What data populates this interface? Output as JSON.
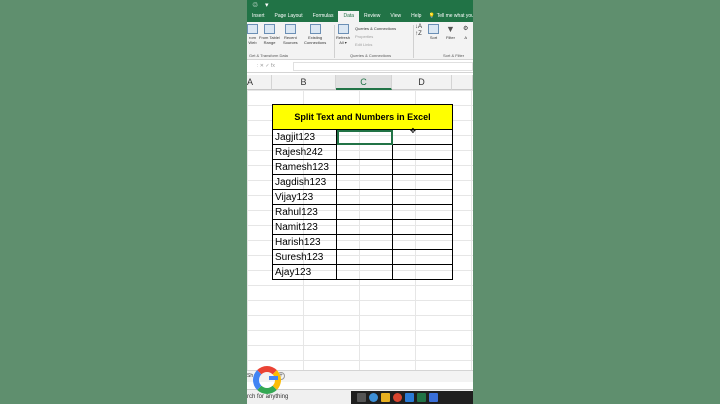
{
  "ribbon": {
    "tabs": [
      "Insert",
      "Page Layout",
      "Formulas",
      "Data",
      "Review",
      "View",
      "Help"
    ],
    "active_tab": "Data",
    "tell_me": "Tell me what you wa",
    "buttons": {
      "from_web": "rom\nWeb",
      "from_table": "From Table/\nRange",
      "recent_sources": "Recent\nSources",
      "existing_connections": "Existing\nConnections",
      "refresh_all": "Refresh\nAll ▾",
      "sort": "Sort",
      "filter": "Filter",
      "advanced": "A"
    },
    "queries": {
      "queries_connections": "Queries & Connections",
      "properties": "Properties",
      "edit_links": "Edit Links"
    },
    "groups": {
      "get_transform": "Get & Transform Data",
      "queries_connections": "Queries & Connections",
      "sort_filter": "Sort & Filter"
    }
  },
  "formula_bar": {
    "controls": ":   ✕   ✓   fx"
  },
  "columns": [
    "A",
    "B",
    "C",
    "D"
  ],
  "selected_column": "C",
  "sheet": {
    "title": "Split Text and Numbers in Excel",
    "rows": [
      "Jagjit123",
      "Rajesh242",
      "Ramesh123",
      "Jagdish123",
      "Vijay123",
      "Rahul123",
      "Namit123",
      "Harish123",
      "Suresh123",
      "Ajay123"
    ]
  },
  "sheet_tab": "Sh",
  "taskbar": {
    "search": "rch for anything"
  },
  "colors": {
    "accent": "#217346",
    "title_fill": "#ffff00",
    "background": "#5f8f6e"
  }
}
